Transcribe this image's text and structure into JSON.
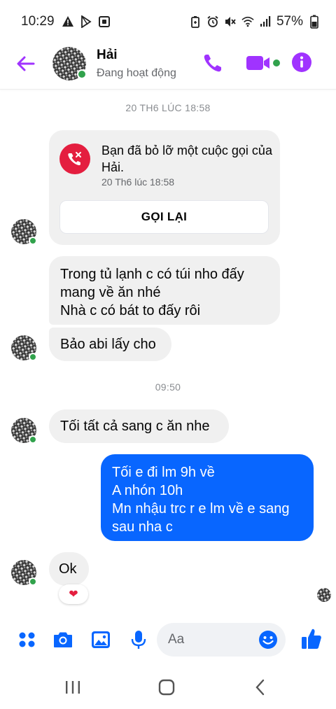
{
  "status_bar": {
    "time": "10:29",
    "battery": "57%",
    "left_icons": [
      "warning-icon",
      "play-store-icon",
      "calendar-icon"
    ],
    "right_icons": [
      "battery-saver-icon",
      "alarm-icon",
      "mute-icon",
      "wifi-icon",
      "signal-icon",
      "battery-icon"
    ]
  },
  "header": {
    "name": "Hải",
    "status": "Đang hoạt động"
  },
  "chat": {
    "timestamp_1": "20 TH6 LÚC 18:58",
    "missed_call": {
      "text": "Bạn đã bỏ lỡ một cuộc gọi của Hải.",
      "time": "20 Th6 lúc 18:58",
      "button": "GỌI LẠI"
    },
    "msg_1": [
      "Trong tủ lạnh c có túi nho đấy",
      "mang về ăn nhé",
      "Nhà c có bát to đấy rôi"
    ],
    "msg_2": "Bảo abi lấy cho",
    "timestamp_2": "09:50",
    "msg_3": "Tối tất cả sang c ăn nhe",
    "msg_out": [
      "Tối e đi lm 9h về",
      "A nhón 10h",
      "Mn nhậu trc r e lm về e sang",
      "sau nha c"
    ],
    "msg_4": "Ok",
    "reaction": "heart"
  },
  "composer": {
    "placeholder": "Aa"
  },
  "colors": {
    "messenger_purple": "#a033ff",
    "outgoing_blue": "#0866ff",
    "composer_blue": "#0866ff",
    "incoming_bg": "#f0f0f0",
    "online_green": "#31a24c",
    "missed_red": "#e41e3f"
  }
}
